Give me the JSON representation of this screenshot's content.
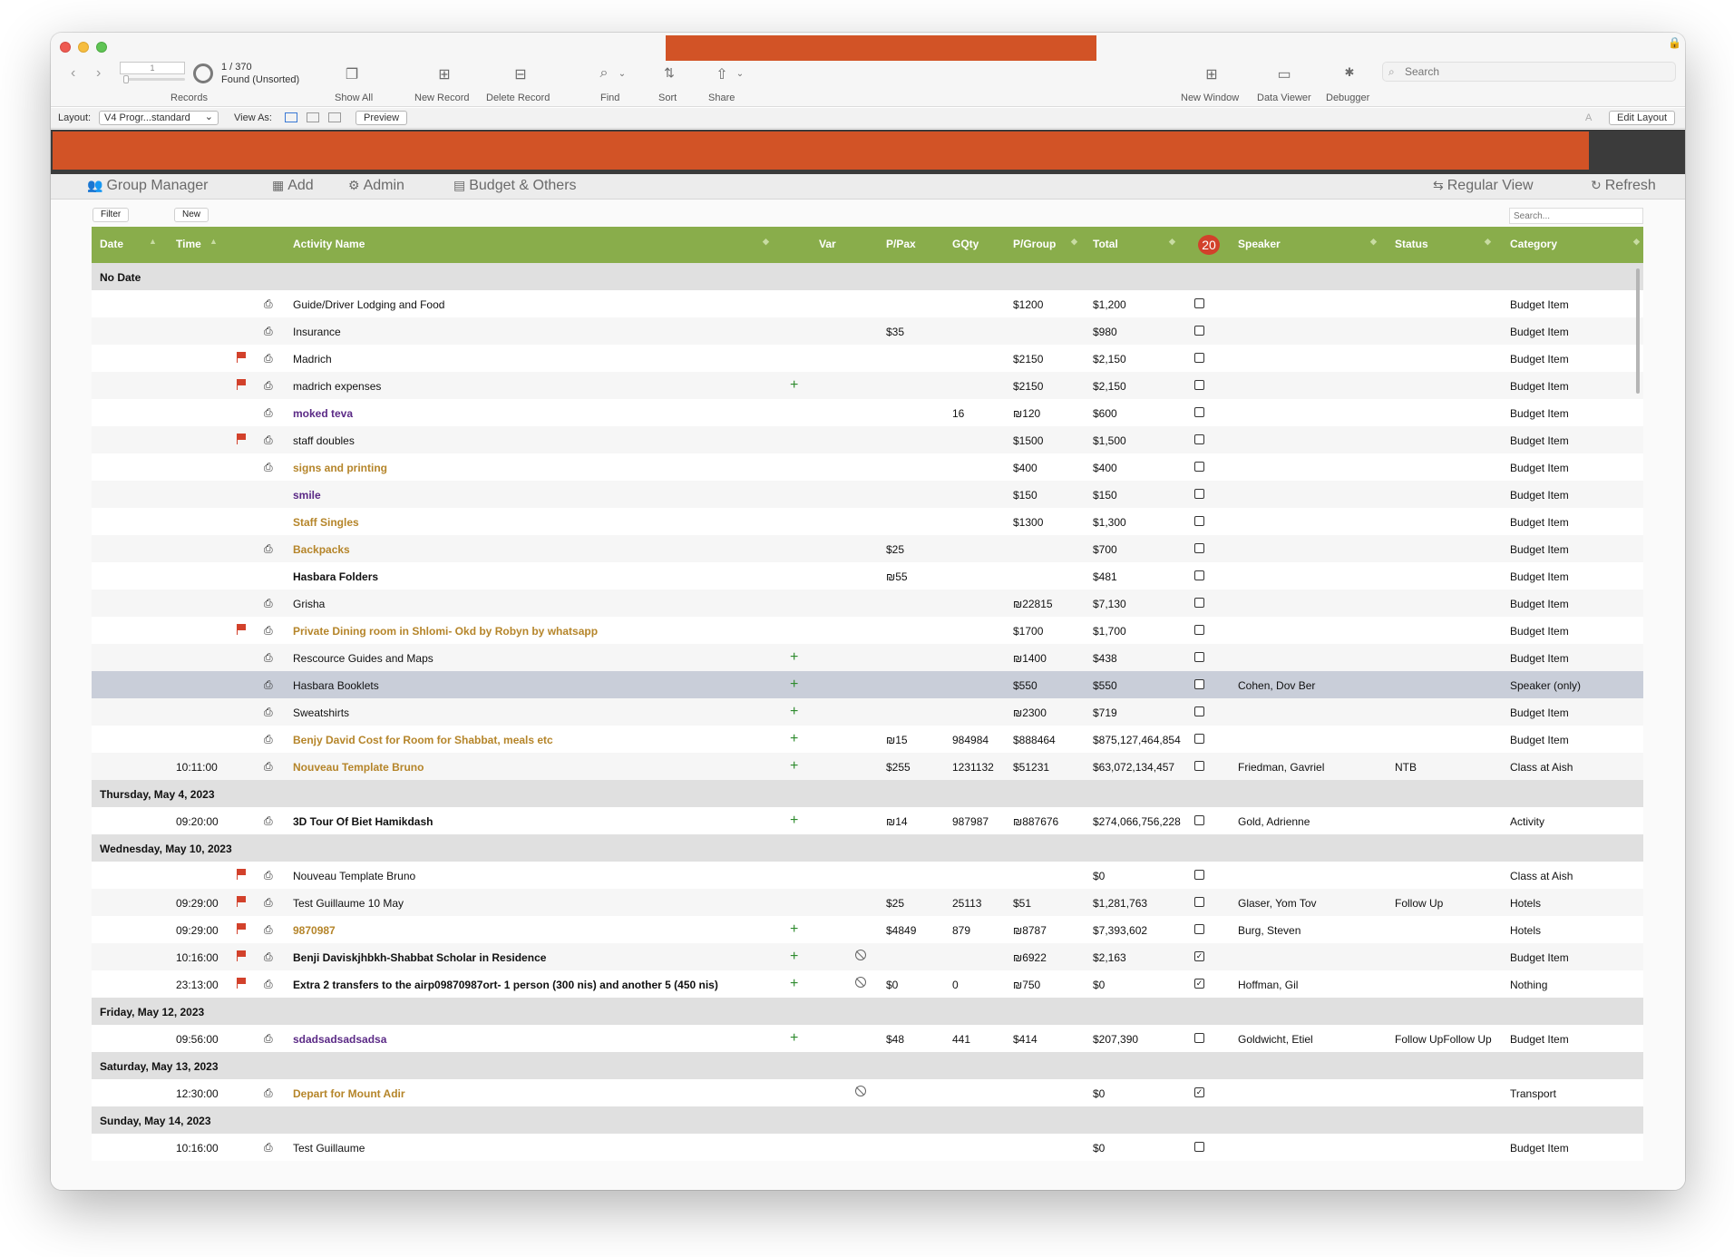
{
  "toolbar": {
    "record_input": "1",
    "record_count": "1 / 370",
    "record_status": "Found (Unsorted)",
    "records_label": "Records",
    "show_all": "Show All",
    "new_record": "New Record",
    "delete_record": "Delete Record",
    "find": "Find",
    "sort": "Sort",
    "share": "Share",
    "new_window": "New Window",
    "data_viewer": "Data Viewer",
    "debugger": "Debugger",
    "search_placeholder": "Search"
  },
  "layout_bar": {
    "layout_label": "Layout:",
    "layout_value": "V4 Progr...standard",
    "view_as_label": "View As:",
    "preview": "Preview",
    "edit_layout": "Edit Layout"
  },
  "menu": {
    "group_manager": "Group Manager",
    "add": "Add",
    "admin": "Admin",
    "budget": "Budget & Others",
    "regular_view": "Regular View",
    "refresh": "Refresh"
  },
  "list": {
    "filter": "Filter",
    "new": "New",
    "search_placeholder": "Search...",
    "badge": "20",
    "columns": {
      "date": "Date",
      "time": "Time",
      "activity": "Activity Name",
      "var": "Var",
      "ppax": "P/Pax",
      "gqty": "GQty",
      "pgroup": "P/Group",
      "total": "Total",
      "speaker": "Speaker",
      "status": "Status",
      "category": "Category"
    }
  },
  "colors": {
    "header_green": "#89ad4b",
    "accent_red": "#d25326",
    "gold_text": "#b5852a",
    "purple_text": "#5b2a86",
    "plus_green": "#2e8b2e"
  },
  "rows": [
    {
      "type": "group",
      "label": "No Date"
    },
    {
      "time": "",
      "flag": false,
      "printer": true,
      "name": "Guide/Driver Lodging and Food",
      "style": "normal",
      "plus": false,
      "noentry": false,
      "ppax": "",
      "gqty": "",
      "pgroup": "$1200",
      "total": "$1,200",
      "checked": false,
      "speaker": "",
      "status": "",
      "category": "Budget Item"
    },
    {
      "time": "",
      "flag": false,
      "printer": true,
      "name": "Insurance",
      "style": "normal",
      "plus": false,
      "noentry": false,
      "ppax": "$35",
      "gqty": "",
      "pgroup": "",
      "total": "$980",
      "checked": false,
      "speaker": "",
      "status": "",
      "category": "Budget Item"
    },
    {
      "time": "",
      "flag": true,
      "printer": true,
      "name": "Madrich",
      "style": "normal",
      "plus": false,
      "noentry": false,
      "ppax": "",
      "gqty": "",
      "pgroup": "$2150",
      "total": "$2,150",
      "checked": false,
      "speaker": "",
      "status": "",
      "category": "Budget Item"
    },
    {
      "time": "",
      "flag": true,
      "printer": true,
      "name": "madrich expenses",
      "style": "normal",
      "plus": true,
      "noentry": false,
      "ppax": "",
      "gqty": "",
      "pgroup": "$2150",
      "total": "$2,150",
      "checked": false,
      "speaker": "",
      "status": "",
      "category": "Budget Item"
    },
    {
      "time": "",
      "flag": false,
      "printer": true,
      "name": "moked teva",
      "style": "purple",
      "plus": false,
      "noentry": false,
      "ppax": "",
      "gqty": "16",
      "pgroup": "₪120",
      "total": "$600",
      "checked": false,
      "speaker": "",
      "status": "",
      "category": "Budget Item"
    },
    {
      "time": "",
      "flag": true,
      "printer": true,
      "name": "staff doubles",
      "style": "normal",
      "plus": false,
      "noentry": false,
      "ppax": "",
      "gqty": "",
      "pgroup": "$1500",
      "total": "$1,500",
      "checked": false,
      "speaker": "",
      "status": "",
      "category": "Budget Item"
    },
    {
      "time": "",
      "flag": false,
      "printer": true,
      "name": "signs and printing",
      "style": "gold",
      "plus": false,
      "noentry": false,
      "ppax": "",
      "gqty": "",
      "pgroup": "$400",
      "total": "$400",
      "checked": false,
      "speaker": "",
      "status": "",
      "category": "Budget Item"
    },
    {
      "time": "",
      "flag": false,
      "printer": false,
      "name": "smile",
      "style": "purple",
      "plus": false,
      "noentry": false,
      "ppax": "",
      "gqty": "",
      "pgroup": "$150",
      "total": "$150",
      "checked": false,
      "speaker": "",
      "status": "",
      "category": "Budget Item"
    },
    {
      "time": "",
      "flag": false,
      "printer": false,
      "name": "Staff Singles",
      "style": "gold",
      "plus": false,
      "noentry": false,
      "ppax": "",
      "gqty": "",
      "pgroup": "$1300",
      "total": "$1,300",
      "checked": false,
      "speaker": "",
      "status": "",
      "category": "Budget Item"
    },
    {
      "time": "",
      "flag": false,
      "printer": true,
      "name": "Backpacks",
      "style": "gold",
      "plus": false,
      "noentry": false,
      "ppax": "$25",
      "gqty": "",
      "pgroup": "",
      "total": "$700",
      "checked": false,
      "speaker": "",
      "status": "",
      "category": "Budget Item"
    },
    {
      "time": "",
      "flag": false,
      "printer": false,
      "name": "Hasbara Folders",
      "style": "bold",
      "plus": false,
      "noentry": false,
      "ppax": "₪55",
      "gqty": "",
      "pgroup": "",
      "total": "$481",
      "checked": false,
      "speaker": "",
      "status": "",
      "category": "Budget Item"
    },
    {
      "time": "",
      "flag": false,
      "printer": true,
      "name": "Grisha",
      "style": "normal",
      "plus": false,
      "noentry": false,
      "ppax": "",
      "gqty": "",
      "pgroup": "₪22815",
      "total": "$7,130",
      "checked": false,
      "speaker": "",
      "status": "",
      "category": "Budget Item"
    },
    {
      "time": "",
      "flag": true,
      "printer": true,
      "name": "Private Dining room in Shlomi- Okd by Robyn by whatsapp",
      "style": "gold",
      "plus": false,
      "noentry": false,
      "ppax": "",
      "gqty": "",
      "pgroup": "$1700",
      "total": "$1,700",
      "checked": false,
      "speaker": "",
      "status": "",
      "category": "Budget Item"
    },
    {
      "time": "",
      "flag": false,
      "printer": true,
      "name": "Rescource Guides and Maps",
      "style": "normal",
      "plus": true,
      "noentry": false,
      "ppax": "",
      "gqty": "",
      "pgroup": "₪1400",
      "total": "$438",
      "checked": false,
      "speaker": "",
      "status": "",
      "category": "Budget Item"
    },
    {
      "time": "",
      "flag": false,
      "printer": true,
      "name": "Hasbara Booklets",
      "style": "normal",
      "plus": true,
      "noentry": false,
      "ppax": "",
      "gqty": "",
      "pgroup": "$550",
      "total": "$550",
      "checked": false,
      "speaker": "Cohen, Dov Ber",
      "status": "",
      "category": "Speaker (only)",
      "selected": true
    },
    {
      "time": "",
      "flag": false,
      "printer": true,
      "name": "Sweatshirts",
      "style": "normal",
      "plus": true,
      "noentry": false,
      "ppax": "",
      "gqty": "",
      "pgroup": "₪2300",
      "total": "$719",
      "checked": false,
      "speaker": "",
      "status": "",
      "category": "Budget Item"
    },
    {
      "time": "",
      "flag": false,
      "printer": true,
      "name": "Benjy David Cost for Room for Shabbat, meals etc",
      "style": "gold",
      "plus": true,
      "noentry": false,
      "ppax": "₪15",
      "gqty": "984984",
      "pgroup": "$888464",
      "total": "$875,127,464,854",
      "checked": false,
      "speaker": "",
      "status": "",
      "category": "Budget Item"
    },
    {
      "time": "10:11:00",
      "flag": false,
      "printer": true,
      "name": "Nouveau Template Bruno",
      "style": "gold",
      "plus": true,
      "noentry": false,
      "ppax": "$255",
      "gqty": "1231132",
      "pgroup": "$51231",
      "total": "$63,072,134,457",
      "checked": false,
      "speaker": "Friedman, Gavriel",
      "status": "NTB",
      "category": "Class at Aish"
    },
    {
      "type": "group",
      "label": "Thursday, May 4, 2023"
    },
    {
      "time": "09:20:00",
      "flag": false,
      "printer": true,
      "name": "3D Tour Of Biet Hamikdash",
      "style": "bold",
      "plus": true,
      "noentry": false,
      "ppax": "₪14",
      "gqty": "987987",
      "pgroup": "₪887676",
      "total": "$274,066,756,228",
      "checked": false,
      "speaker": "Gold, Adrienne",
      "status": "",
      "category": "Activity"
    },
    {
      "type": "group",
      "label": "Wednesday, May 10, 2023"
    },
    {
      "time": "",
      "flag": true,
      "printer": true,
      "name": "Nouveau Template Bruno",
      "style": "normal",
      "plus": false,
      "noentry": false,
      "ppax": "",
      "gqty": "",
      "pgroup": "",
      "total": "$0",
      "checked": false,
      "speaker": "",
      "status": "",
      "category": "Class at Aish"
    },
    {
      "time": "09:29:00",
      "flag": true,
      "printer": true,
      "name": "Test Guillaume 10 May",
      "style": "normal",
      "plus": false,
      "noentry": false,
      "ppax": "$25",
      "gqty": "25113",
      "pgroup": "$51",
      "total": "$1,281,763",
      "checked": false,
      "speaker": "Glaser, Yom Tov",
      "status": "Follow Up",
      "category": "Hotels"
    },
    {
      "time": "09:29:00",
      "flag": true,
      "printer": true,
      "name": "9870987",
      "style": "gold",
      "plus": true,
      "noentry": false,
      "ppax": "$4849",
      "gqty": "879",
      "pgroup": "₪8787",
      "total": "$7,393,602",
      "checked": false,
      "speaker": "Burg, Steven",
      "status": "",
      "category": "Hotels"
    },
    {
      "time": "10:16:00",
      "flag": true,
      "printer": true,
      "name": "Benji Daviskjhbkh-Shabbat Scholar in Residence",
      "style": "bold",
      "plus": true,
      "noentry": true,
      "ppax": "",
      "gqty": "",
      "pgroup": "₪6922",
      "total": "$2,163",
      "checked": true,
      "speaker": "",
      "status": "",
      "category": "Budget Item"
    },
    {
      "time": "23:13:00",
      "flag": true,
      "printer": true,
      "name": "Extra 2 transfers to the airp09870987ort- 1 person (300 nis) and another 5 (450 nis)",
      "style": "bold",
      "plus": true,
      "noentry": true,
      "ppax": "$0",
      "gqty": "0",
      "pgroup": "₪750",
      "total": "$0",
      "checked": true,
      "speaker": "Hoffman, Gil",
      "status": "",
      "category": "Nothing"
    },
    {
      "type": "group",
      "label": "Friday, May 12, 2023"
    },
    {
      "time": "09:56:00",
      "flag": false,
      "printer": true,
      "name": "sdadsadsadsadsa",
      "style": "purple",
      "plus": true,
      "noentry": false,
      "ppax": "$48",
      "gqty": "441",
      "pgroup": "$414",
      "total": "$207,390",
      "checked": false,
      "speaker": "Goldwicht, Etiel",
      "status": "Follow UpFollow Up",
      "category": "Budget Item"
    },
    {
      "type": "group",
      "label": "Saturday, May 13, 2023"
    },
    {
      "time": "12:30:00",
      "flag": false,
      "printer": true,
      "name": "Depart for Mount Adir",
      "style": "gold",
      "plus": false,
      "noentry": true,
      "ppax": "",
      "gqty": "",
      "pgroup": "",
      "total": "$0",
      "checked": true,
      "speaker": "",
      "status": "",
      "category": "Transport"
    },
    {
      "type": "group",
      "label": "Sunday, May 14, 2023"
    },
    {
      "time": "10:16:00",
      "flag": false,
      "printer": true,
      "name": "Test Guillaume",
      "style": "normal",
      "plus": false,
      "noentry": false,
      "ppax": "",
      "gqty": "",
      "pgroup": "",
      "total": "$0",
      "checked": false,
      "speaker": "",
      "status": "",
      "category": "Budget Item"
    }
  ]
}
